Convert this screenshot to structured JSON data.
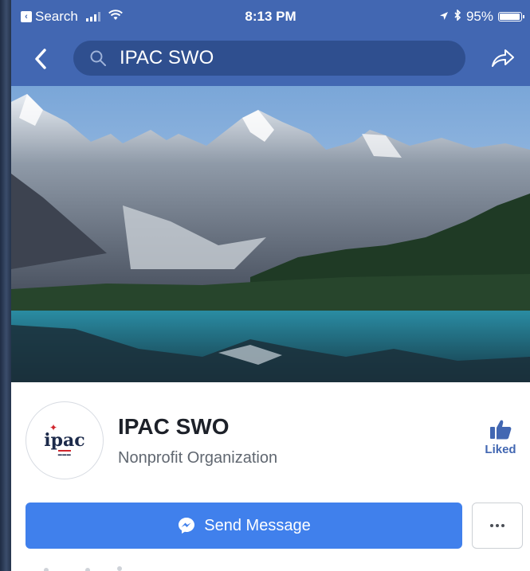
{
  "status_bar": {
    "back_app": "Search",
    "time": "8:13 PM",
    "battery": "95%",
    "battery_level": 0.95
  },
  "nav": {
    "search_query": "IPAC SWO"
  },
  "page": {
    "avatar_logo": "ipac",
    "name": "IPAC SWO",
    "category": "Nonprofit Organization",
    "like_label": "Liked"
  },
  "actions": {
    "send_message": "Send Message"
  },
  "colors": {
    "brand_blue": "#4267b2",
    "button_blue": "#4080ec"
  }
}
